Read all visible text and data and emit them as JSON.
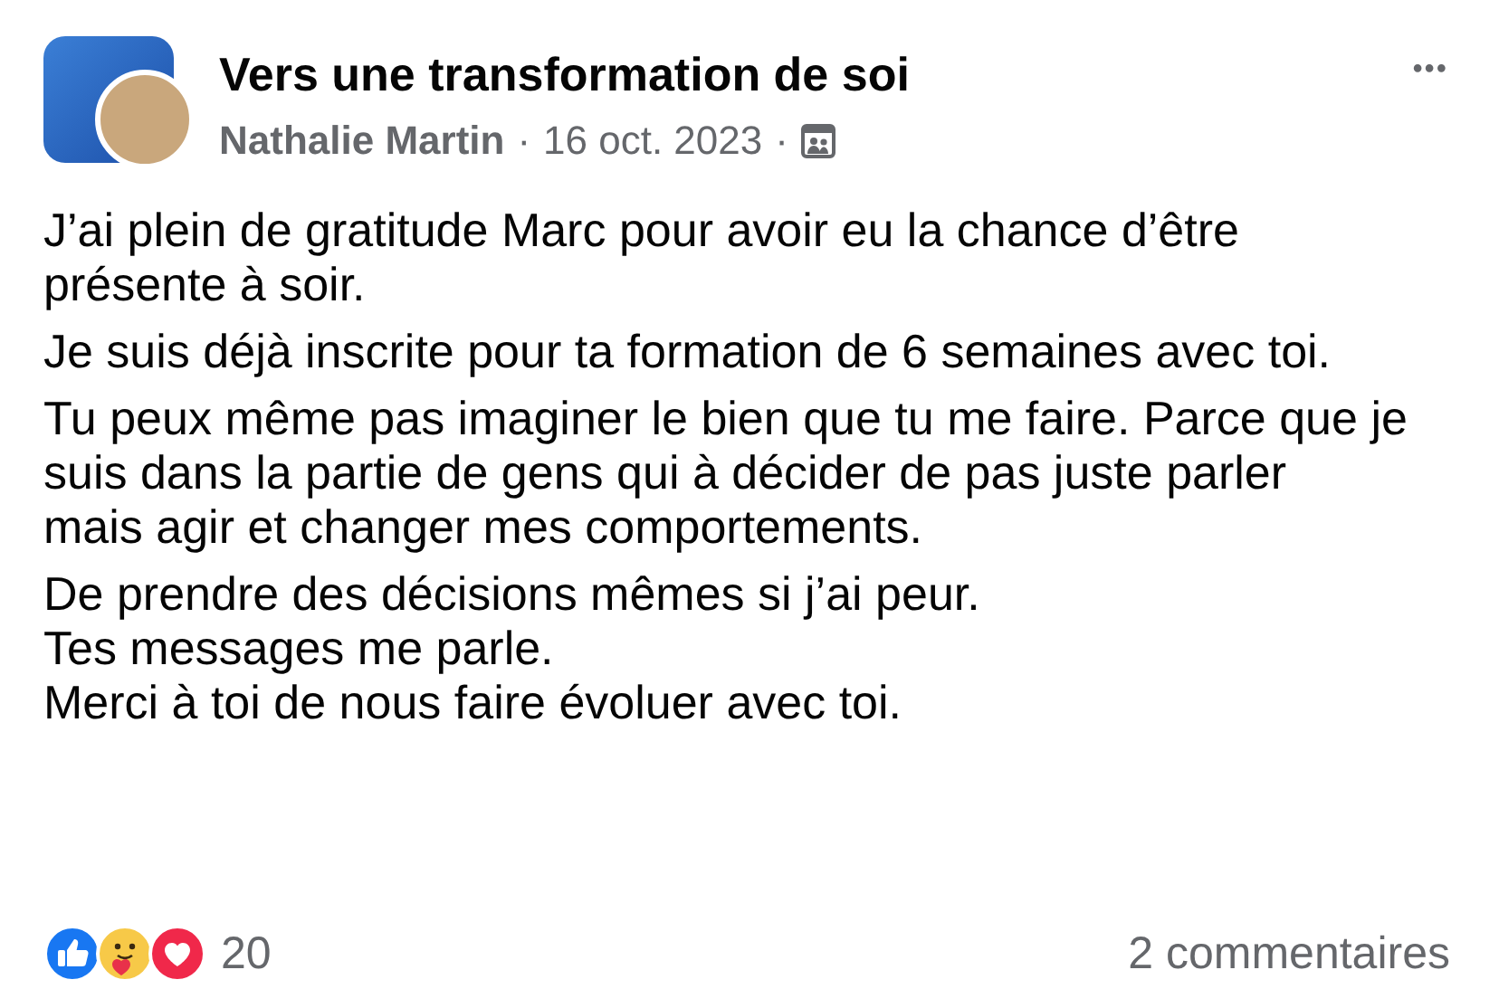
{
  "post": {
    "group_name": "Vers une transformation de soi",
    "author": "Nathalie Martin",
    "separator_1": "·",
    "date": "16 oct. 2023",
    "separator_2": "·",
    "menu": "•••"
  },
  "body": [
    [
      "J’ai plein de gratitude Marc pour avoir eu la chance d’être",
      "présente à soir."
    ],
    [
      "Je suis déjà inscrite pour ta formation de 6 semaines avec toi."
    ],
    [
      "Tu peux même pas imaginer le bien que tu me faire. Parce que je",
      "suis dans la partie de gens qui à décider de pas juste parler",
      "mais agir et changer mes comportements."
    ],
    [
      "De prendre des décisions mêmes si j’ai peur.",
      "Tes messages me parle.",
      "Merci à toi de nous faire évoluer avec toi."
    ]
  ],
  "footer": {
    "reactions": [
      {
        "kind": "like"
      },
      {
        "kind": "care"
      },
      {
        "kind": "love"
      }
    ],
    "reaction_count": "20",
    "comments": "2 commentaires"
  }
}
